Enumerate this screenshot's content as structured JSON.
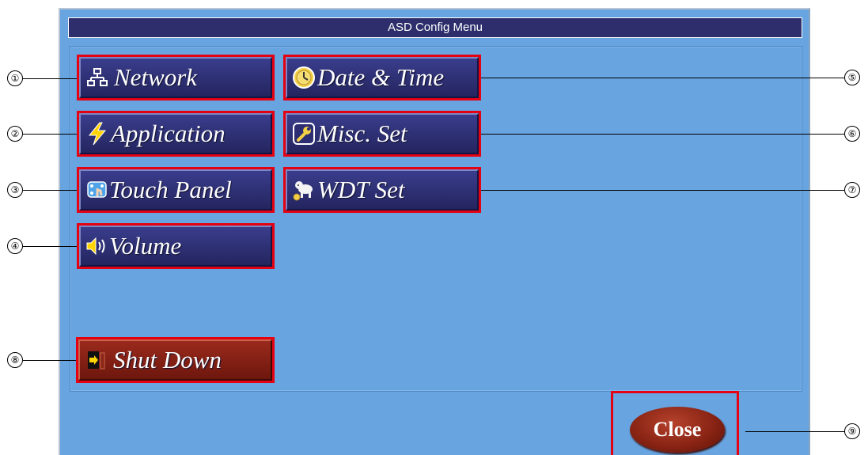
{
  "window": {
    "title": "ASD Config Menu"
  },
  "menu": {
    "network": "Network",
    "application": "Application",
    "touch_panel": "Touch Panel",
    "volume": "Volume",
    "date_time": "Date & Time",
    "misc_set": "Misc. Set",
    "wdt_set": "WDT Set",
    "shut_down": "Shut Down"
  },
  "close_label": "Close",
  "callouts": [
    "①",
    "②",
    "③",
    "④",
    "⑤",
    "⑥",
    "⑦",
    "⑧",
    "⑨"
  ],
  "colors": {
    "window_bg": "#67a4e0",
    "titlebar_bg": "#2d2e6b",
    "button_bg": "#2c2d72",
    "highlight_border": "#e50012",
    "shutdown_bg": "#8a2414"
  },
  "icons": {
    "network": "network-icon",
    "application": "lightning-icon",
    "touch_panel": "touch-panel-icon",
    "volume": "speaker-icon",
    "date_time": "clock-icon",
    "misc_set": "wrench-icon",
    "wdt_set": "dog-icon",
    "shut_down": "exit-door-icon"
  }
}
